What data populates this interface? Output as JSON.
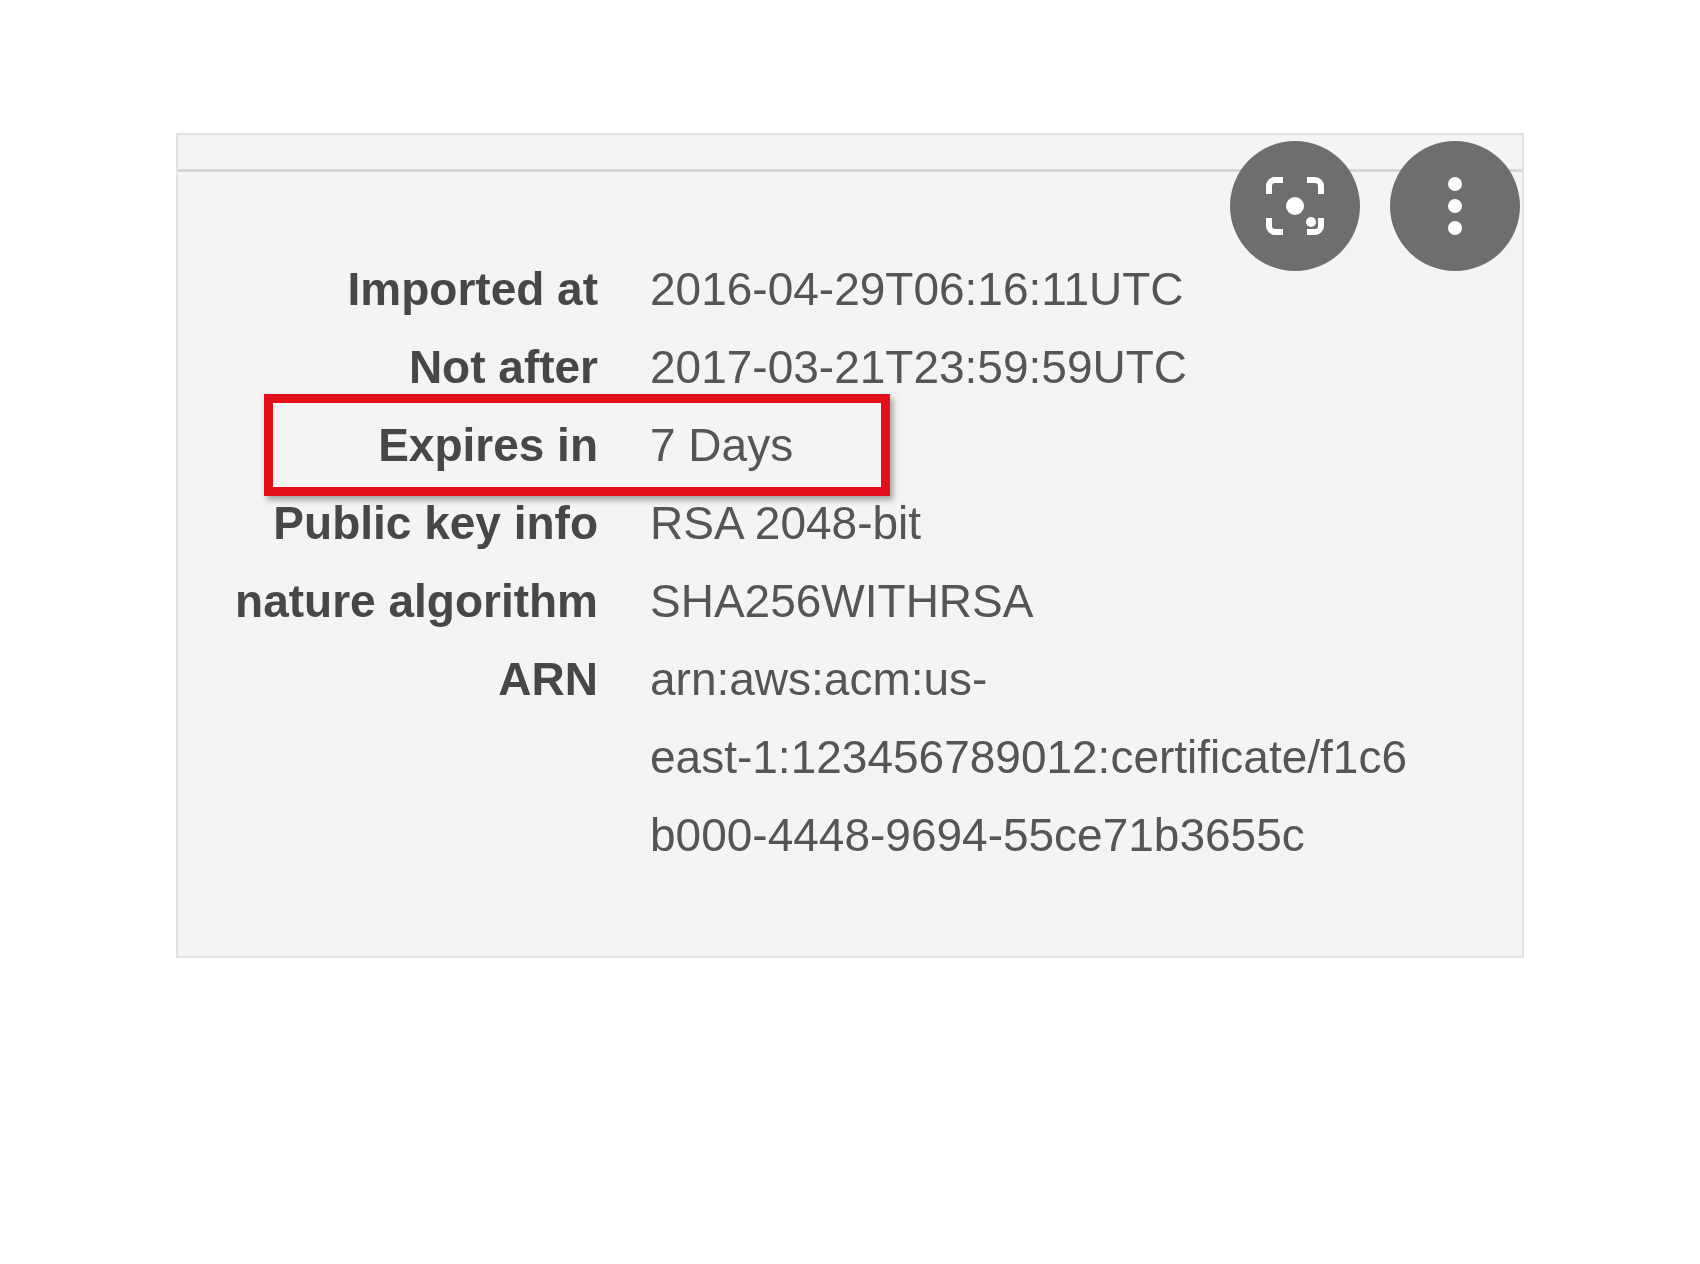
{
  "toolbar": {
    "buttons": [
      {
        "kind": "lens"
      },
      {
        "kind": "more"
      }
    ]
  },
  "details": [
    {
      "label": "Imported at",
      "lines": [
        "2016-04-29T06:16:11UTC"
      ],
      "highlighted": false
    },
    {
      "label": "Not after",
      "lines": [
        "2017-03-21T23:59:59UTC"
      ],
      "highlighted": false
    },
    {
      "label": "Expires in",
      "lines": [
        "7 Days"
      ],
      "highlighted": true
    },
    {
      "label": "Public key info",
      "lines": [
        "RSA 2048-bit"
      ],
      "highlighted": false
    },
    {
      "label": "nature algorithm",
      "lines": [
        "SHA256WITHRSA"
      ],
      "highlighted": false
    },
    {
      "label": "ARN",
      "lines": [
        "arn:aws:acm:us-",
        "east-1:123456789012:certificate/f1c6",
        "b000-4448-9694-55ce71b3655c"
      ],
      "highlighted": false
    }
  ]
}
